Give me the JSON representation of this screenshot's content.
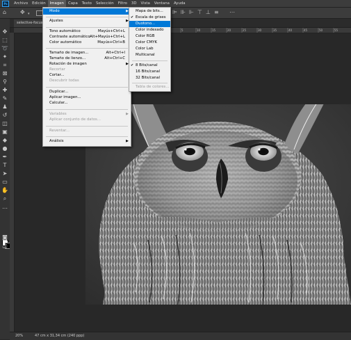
{
  "menubar": {
    "logo": "Ps",
    "items": [
      "Archivo",
      "Edición",
      "Imagen",
      "Capa",
      "Texto",
      "Selección",
      "Filtro",
      "3D",
      "Vista",
      "Ventana",
      "Ayuda"
    ]
  },
  "document": {
    "tab_title": "selective-focus",
    "zoom": "20%",
    "info": "47 cm x 31,34 cm (240 ppp)"
  },
  "image_menu": {
    "mode": "Modo",
    "adjustments": "Ajustes",
    "auto_tone": "Tono automático",
    "auto_tone_sc": "Mayús+Ctrl+L",
    "auto_contrast": "Contraste automático",
    "auto_contrast_sc": "Alt+Mayús+Ctrl+L",
    "auto_color": "Color automático",
    "auto_color_sc": "Mayús+Ctrl+B",
    "image_size": "Tamaño de imagen...",
    "image_size_sc": "Alt+Ctrl+I",
    "canvas_size": "Tamaño de lienzo...",
    "canvas_size_sc": "Alt+Ctrl+C",
    "rotation": "Rotación de imagen",
    "crop": "Recortar",
    "trim": "Cortar...",
    "reveal_all": "Descubrir todas",
    "duplicate": "Duplicar...",
    "apply_image": "Aplicar imagen...",
    "calculations": "Calcular...",
    "variables": "Variables",
    "apply_data_set": "Aplicar conjunto de datos...",
    "trap": "Reventar...",
    "analysis": "Análisis"
  },
  "mode_menu": {
    "bitmap": "Mapa de bits...",
    "grayscale": "Escala de grises",
    "duotone": "Duotono...",
    "indexed": "Color indexado",
    "rgb": "Color RGB",
    "cmyk": "Color CMYK",
    "lab": "Color Lab",
    "multichannel": "Multicanal",
    "bits8": "8 Bits/canal",
    "bits16": "16 Bits/canal",
    "bits32": "32 Bits/canal",
    "color_table": "Tabla de colores..."
  },
  "ruler_ticks": [
    "5",
    "10",
    "15",
    "20",
    "25",
    "30",
    "35",
    "40",
    "45",
    "50",
    "55"
  ]
}
